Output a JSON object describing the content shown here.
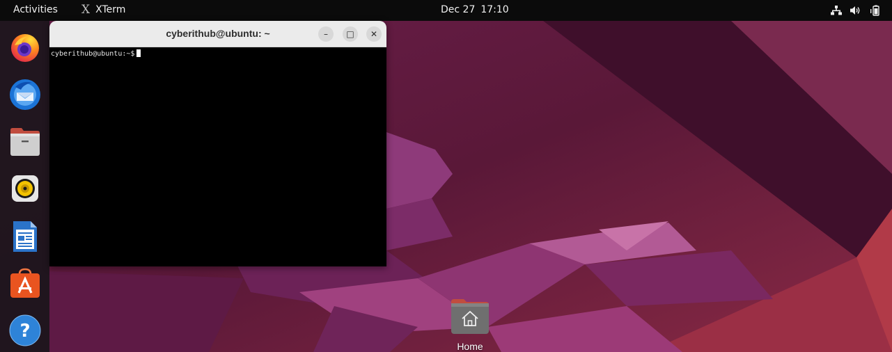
{
  "topbar": {
    "activities": "Activities",
    "app_name": "XTerm",
    "app_icon": "X",
    "clock_date": "Dec 27",
    "clock_time": "17:10",
    "tray_icons": [
      "network-icon",
      "volume-icon",
      "battery-icon"
    ]
  },
  "dock": {
    "items": [
      {
        "name": "firefox",
        "icon": "firefox-icon"
      },
      {
        "name": "thunderbird",
        "icon": "thunderbird-icon"
      },
      {
        "name": "files",
        "icon": "files-icon"
      },
      {
        "name": "rhythmbox",
        "icon": "rhythmbox-icon"
      },
      {
        "name": "libreoffice-writer",
        "icon": "writer-icon"
      },
      {
        "name": "ubuntu-software",
        "icon": "software-icon"
      },
      {
        "name": "help",
        "icon": "help-icon",
        "glyph": "?"
      }
    ]
  },
  "terminal": {
    "title": "cyberithub@ubuntu: ~",
    "prompt": "cyberithub@ubuntu:~$",
    "buttons": {
      "minimize": "–",
      "maximize": "□",
      "close": "✕"
    }
  },
  "desktop": {
    "home_label": "Home",
    "home_icon": "home-folder-icon"
  },
  "colors": {
    "topbar": "#0b0b0b",
    "terminal_bg": "#000000",
    "header_bg": "#ebebeb",
    "wallpaper_base": "#5a1a3e",
    "accent_orange": "#e95420"
  }
}
